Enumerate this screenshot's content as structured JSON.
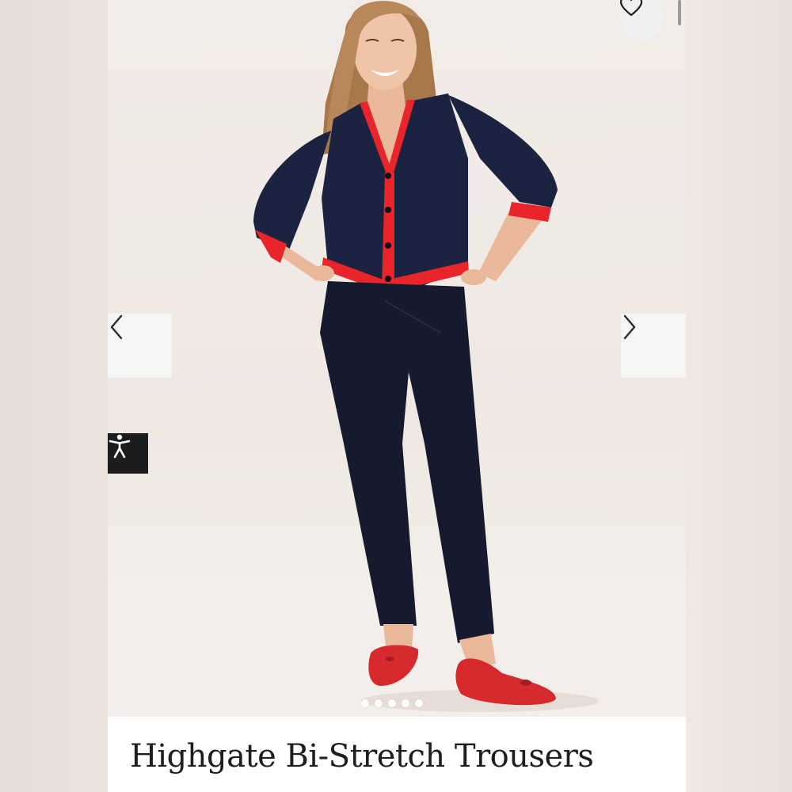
{
  "product": {
    "title": "Highgate Bi-Stretch Trousers"
  },
  "gallery": {
    "image_count": 5,
    "active_index": 0
  },
  "icons": {
    "wishlist": "heart-outline-icon",
    "previous": "chevron-left-icon",
    "next": "chevron-right-icon",
    "accessibility": "accessibility-person-icon"
  },
  "colors": {
    "cardigan": "#1b2340",
    "trim": "#e8252b",
    "trousers": "#151a2e",
    "shoes": "#d62a2e",
    "accessibility_bg": "#1d1d1d"
  }
}
